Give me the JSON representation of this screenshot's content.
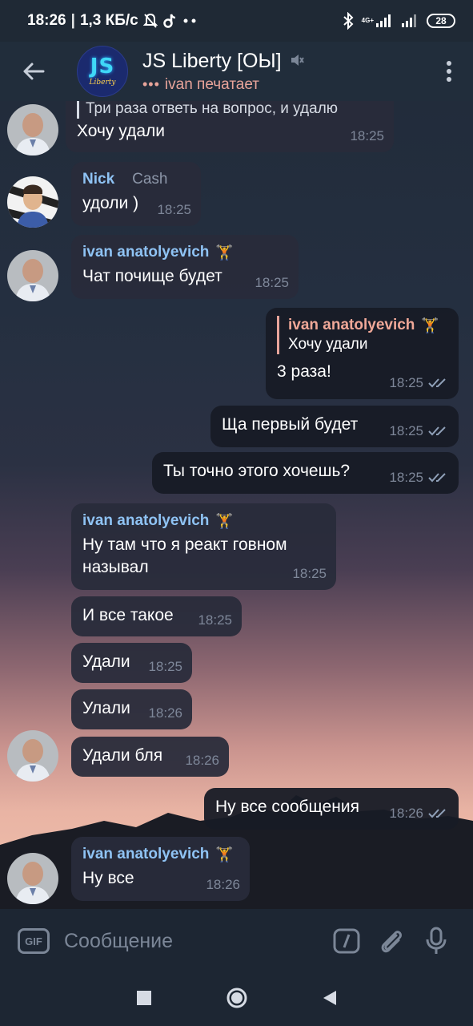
{
  "status_bar": {
    "time": "18:26",
    "speed": "1,3 КБ/с",
    "network_label": "4G+",
    "battery": "28",
    "icons": [
      "mute-notifications-icon",
      "tiktok-icon",
      "more-dots-icon",
      "bluetooth-icon",
      "signal-icon",
      "signal-icon",
      "battery-icon"
    ]
  },
  "header": {
    "title": "JS Liberty [ОЫ]",
    "status": "ivan печатает",
    "avatar_main": "JS",
    "avatar_sub": "Liberty"
  },
  "messages": {
    "m0": {
      "quote": "Три раза ответь на вопрос, и удалю",
      "text": "Хочу удали",
      "time": "18:25"
    },
    "m1": {
      "sender": "Nick",
      "tag": "Cash",
      "text": "удоли )",
      "time": "18:25"
    },
    "m2": {
      "sender": "ivan anatolyevich",
      "text": "Чат почище будет",
      "time": "18:25"
    },
    "m3": {
      "reply_name": "ivan anatolyevich",
      "reply_text": "Хочу удали",
      "text": "3 раза!",
      "time": "18:25"
    },
    "m4": {
      "text": "Ща первый будет",
      "time": "18:25"
    },
    "m5": {
      "text": "Ты точно этого хочешь?",
      "time": "18:25"
    },
    "m6": {
      "sender": "ivan anatolyevich",
      "text": "Ну там что я реакт говном называл",
      "time": "18:25"
    },
    "m7": {
      "text": "И все такое",
      "time": "18:25"
    },
    "m8": {
      "text": "Удали",
      "time": "18:25"
    },
    "m9": {
      "text": "Улали",
      "time": "18:26"
    },
    "m10": {
      "text": "Удали бля",
      "time": "18:26"
    },
    "m11": {
      "text": "Ну все сообщения",
      "time": "18:26"
    },
    "m12": {
      "sender": "ivan anatolyevich",
      "text": "Ну все",
      "time": "18:26"
    }
  },
  "input": {
    "gif_label": "GIF",
    "placeholder": "Сообщение"
  },
  "colors": {
    "sender_ivan": "#8fc3f4",
    "reply_accent": "#e8a49a",
    "header_bg": "#212d3b"
  }
}
